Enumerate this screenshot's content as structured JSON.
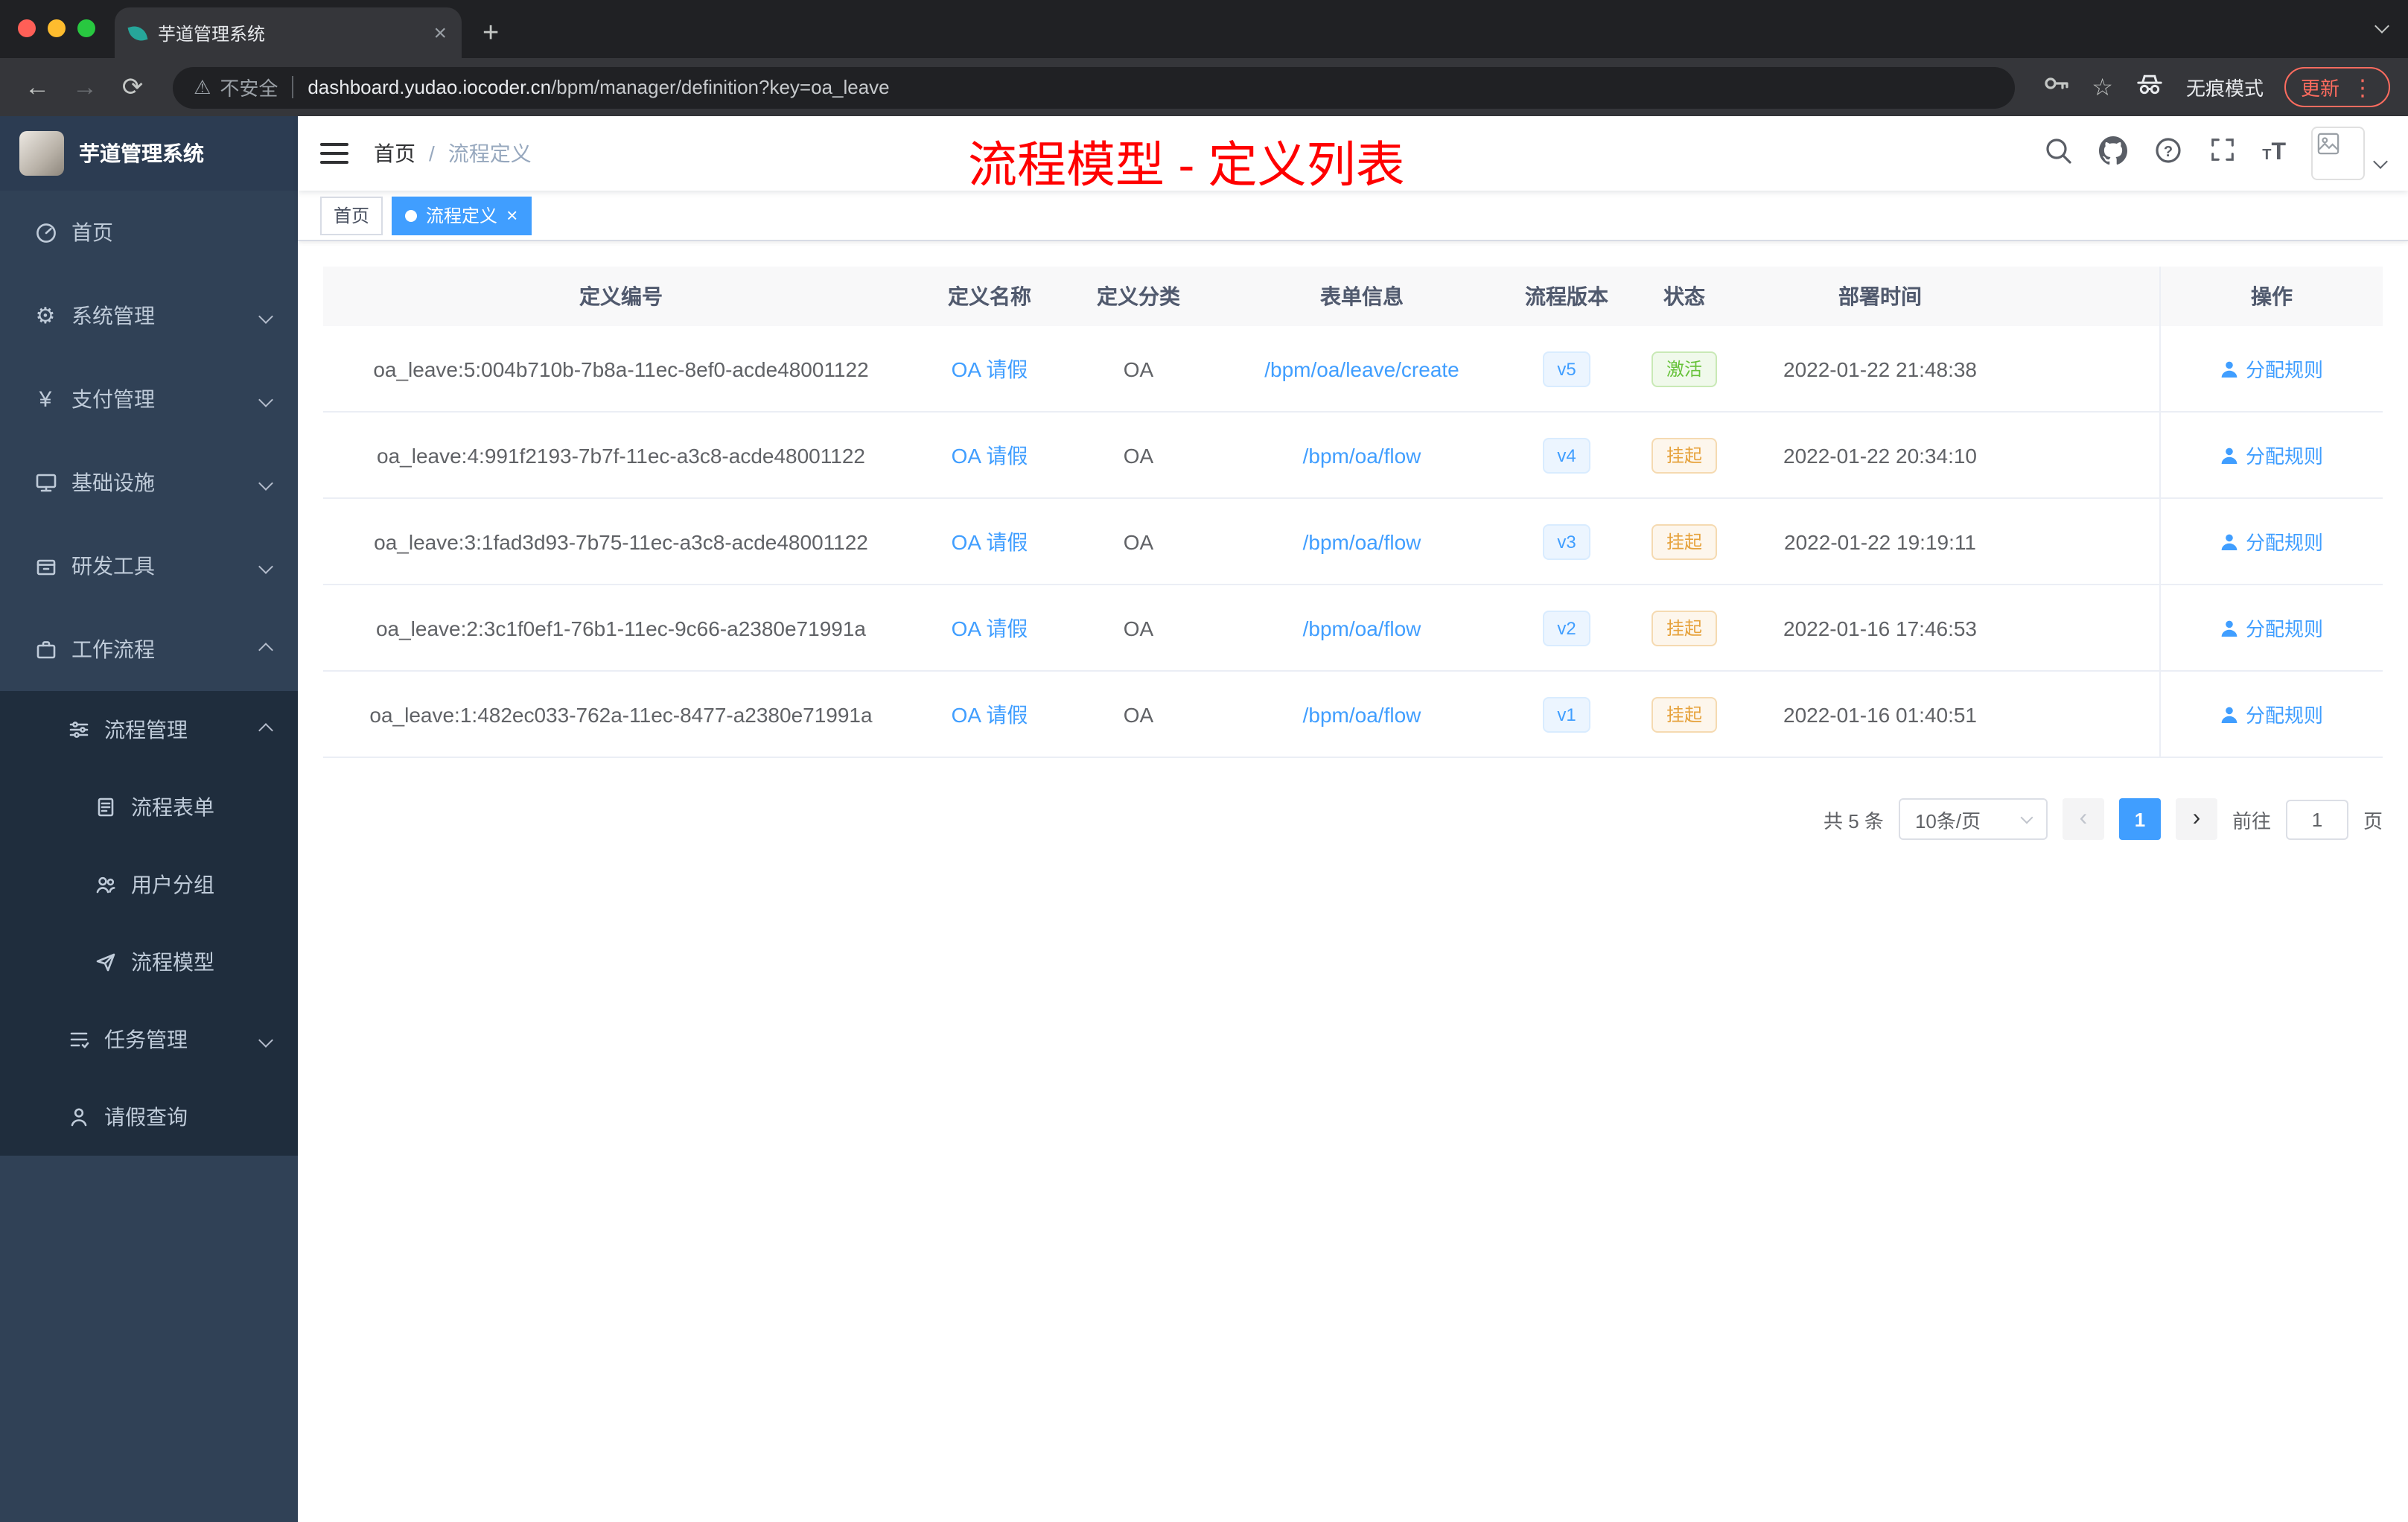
{
  "colors": {
    "accent": "#409eff",
    "success": "#67c23a",
    "warning": "#e6a23c",
    "annotation_red": "#ff0000",
    "sidebar_bg": "#304156",
    "update_chip": "#ff6c5f"
  },
  "browser": {
    "tab_title": "芋道管理系统",
    "security_label": "不安全",
    "url_domain": "dashboard.yudao.iocoder.cn",
    "url_path": "/bpm/manager/definition?key=oa_leave",
    "incognito_label": "无痕模式",
    "update_label": "更新"
  },
  "sidebar": {
    "logo_title": "芋道管理系统",
    "items": [
      {
        "label": "首页"
      },
      {
        "label": "系统管理"
      },
      {
        "label": "支付管理"
      },
      {
        "label": "基础设施"
      },
      {
        "label": "研发工具"
      },
      {
        "label": "工作流程"
      },
      {
        "label": "流程管理"
      },
      {
        "label": "流程表单"
      },
      {
        "label": "用户分组"
      },
      {
        "label": "流程模型"
      },
      {
        "label": "任务管理"
      },
      {
        "label": "请假查询"
      }
    ]
  },
  "navbar": {
    "breadcrumb_home": "首页",
    "breadcrumb_separator": "/",
    "breadcrumb_current": "流程定义",
    "annotation": "流程模型 - 定义列表"
  },
  "tags": {
    "home": "首页",
    "active": "流程定义"
  },
  "table": {
    "columns": [
      "定义编号",
      "定义名称",
      "定义分类",
      "表单信息",
      "流程版本",
      "状态",
      "部署时间",
      "操作"
    ],
    "rows": [
      {
        "id": "oa_leave:5:004b710b-7b8a-11ec-8ef0-acde48001122",
        "name": "OA 请假",
        "category": "OA",
        "form": "/bpm/oa/leave/create",
        "version": "v5",
        "status": "激活",
        "time": "2022-01-22 21:48:38",
        "action": "分配规则"
      },
      {
        "id": "oa_leave:4:991f2193-7b7f-11ec-a3c8-acde48001122",
        "name": "OA 请假",
        "category": "OA",
        "form": "/bpm/oa/flow",
        "version": "v4",
        "status": "挂起",
        "time": "2022-01-22 20:34:10",
        "action": "分配规则"
      },
      {
        "id": "oa_leave:3:1fad3d93-7b75-11ec-a3c8-acde48001122",
        "name": "OA 请假",
        "category": "OA",
        "form": "/bpm/oa/flow",
        "version": "v3",
        "status": "挂起",
        "time": "2022-01-22 19:19:11",
        "action": "分配规则"
      },
      {
        "id": "oa_leave:2:3c1f0ef1-76b1-11ec-9c66-a2380e71991a",
        "name": "OA 请假",
        "category": "OA",
        "form": "/bpm/oa/flow",
        "version": "v2",
        "status": "挂起",
        "time": "2022-01-16 17:46:53",
        "action": "分配规则"
      },
      {
        "id": "oa_leave:1:482ec033-762a-11ec-8477-a2380e71991a",
        "name": "OA 请假",
        "category": "OA",
        "form": "/bpm/oa/flow",
        "version": "v1",
        "status": "挂起",
        "time": "2022-01-16 01:40:51",
        "action": "分配规则"
      }
    ]
  },
  "pagination": {
    "total_label": "共 5 条",
    "page_size": "10条/页",
    "current_page": "1",
    "goto_label": "前往",
    "goto_value": "1",
    "page_unit": "页"
  }
}
